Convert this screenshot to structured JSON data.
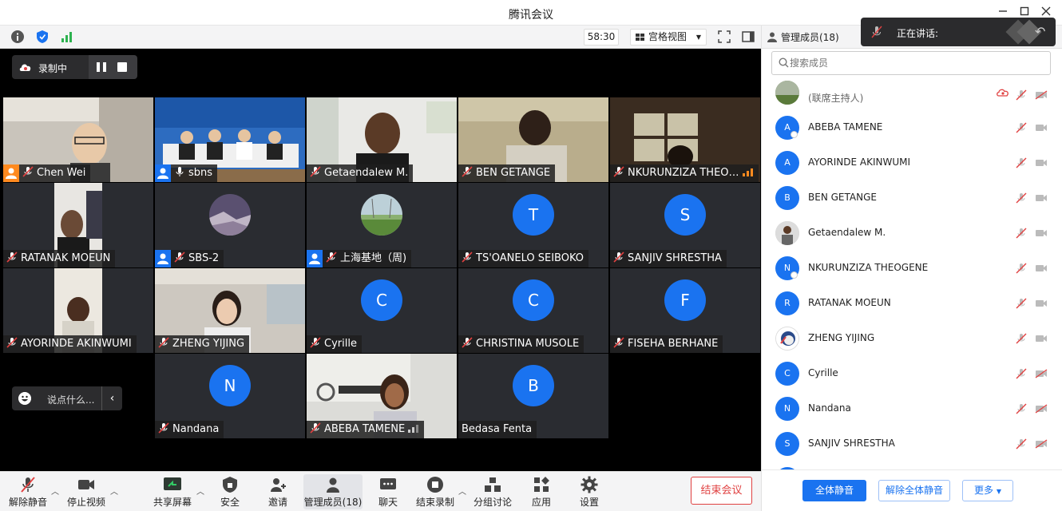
{
  "window": {
    "title": "腾讯会议"
  },
  "toolbar": {
    "timer": "58:30",
    "view_mode": "宫格视图"
  },
  "recording": {
    "label": "录制中"
  },
  "chat_input": {
    "placeholder": "说点什么..."
  },
  "tiles": [
    {
      "name": "Chen Wei",
      "type": "video",
      "badge": "host"
    },
    {
      "name": "sbns",
      "type": "video",
      "badge": "cohost",
      "mic_on": true
    },
    {
      "name": "Getaendalew M.",
      "type": "video"
    },
    {
      "name": "BEN GETANGE",
      "type": "video"
    },
    {
      "name": "NKURUNZIZA THEO…",
      "type": "video",
      "signal": true
    },
    {
      "name": "RATANAK MOEUN",
      "type": "video"
    },
    {
      "name": "SBS-2",
      "type": "photo",
      "badge": "cohost"
    },
    {
      "name": "上海基地（周)",
      "type": "photo",
      "badge": "cohost"
    },
    {
      "name": "TS'OANELO SEIBOKO",
      "type": "letter",
      "letter": "T"
    },
    {
      "name": "SANJIV SHRESTHA",
      "type": "letter",
      "letter": "S"
    },
    {
      "name": "AYORINDE AKINWUMI",
      "type": "video"
    },
    {
      "name": "ZHENG YIJING",
      "type": "video"
    },
    {
      "name": "Cyrille",
      "type": "letter",
      "letter": "C"
    },
    {
      "name": "CHRISTINA MUSOLE",
      "type": "letter",
      "letter": "C"
    },
    {
      "name": "FISEHA BERHANE",
      "type": "letter",
      "letter": "F"
    },
    {
      "name": "Nandana",
      "type": "letter",
      "letter": "N"
    },
    {
      "name": "ABEBA TAMENE",
      "type": "video",
      "signal": true
    },
    {
      "name": "Bedasa Fenta",
      "type": "letter",
      "letter": "B"
    }
  ],
  "bottombar": {
    "unmute": "解除静音",
    "stop_video": "停止视频",
    "share": "共享屏幕",
    "security": "安全",
    "invite": "邀请",
    "members": "管理成员(18)",
    "chat": "聊天",
    "end_record": "结束录制",
    "breakout": "分组讨论",
    "apps": "应用",
    "settings": "设置",
    "end_meeting": "结束会议"
  },
  "panel": {
    "title": "管理成员(18)",
    "speaking_label": "正在讲话:",
    "search_placeholder": "搜索成员",
    "host_sub": "(联席主持人)",
    "members": [
      {
        "name": "ABEBA TAMENE",
        "letter": "A"
      },
      {
        "name": "AYORINDE AKINWUMI",
        "letter": "A"
      },
      {
        "name": "BEN GETANGE",
        "letter": "B"
      },
      {
        "name": "Getaendalew M.",
        "letter": ""
      },
      {
        "name": "NKURUNZIZA THEOGENE",
        "letter": "N"
      },
      {
        "name": "RATANAK MOEUN",
        "letter": "R"
      },
      {
        "name": "ZHENG YIJING",
        "letter": ""
      },
      {
        "name": "Cyrille",
        "letter": "C"
      },
      {
        "name": "Nandana",
        "letter": "N"
      },
      {
        "name": "SANJIV SHRESTHA",
        "letter": "S"
      }
    ],
    "mute_all": "全体静音",
    "unmute_all": "解除全体静音",
    "more": "更多"
  },
  "colors": {
    "accent": "#1a73f0",
    "host_badge": "#ff8a1f",
    "danger": "#e04141",
    "tile_bg": "#2a2c31"
  }
}
